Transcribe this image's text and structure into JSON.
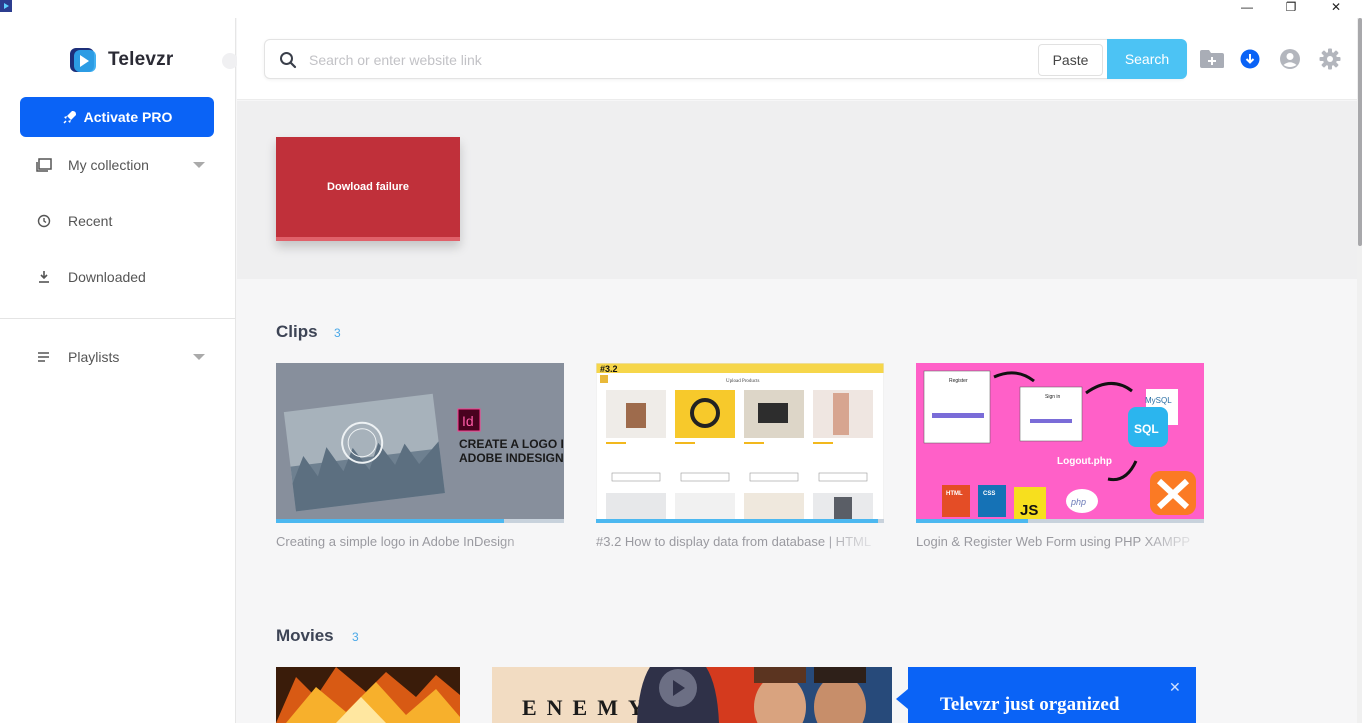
{
  "app": {
    "name": "Televzr"
  },
  "window": {
    "minimize_glyph": "—",
    "restore_glyph": "❐",
    "close_glyph": "✕"
  },
  "sidebar": {
    "activate_label": "Activate PRO",
    "items": [
      {
        "label": "My collection",
        "icon": "collection-icon",
        "has_dropdown": true
      },
      {
        "label": "Recent",
        "icon": "history-icon",
        "has_dropdown": false
      },
      {
        "label": "Downloaded",
        "icon": "download-icon",
        "has_dropdown": false
      },
      {
        "label": "Playlists",
        "icon": "playlist-icon",
        "has_dropdown": true
      }
    ]
  },
  "search": {
    "placeholder": "Search or enter website link",
    "value": "",
    "paste_label": "Paste",
    "search_label": "Search"
  },
  "toolbar": {
    "icons": [
      "add-folder-icon",
      "downloads-icon",
      "account-icon",
      "settings-icon"
    ]
  },
  "failure": {
    "label": "Dowload failure"
  },
  "clips": {
    "title": "Clips",
    "count": "3",
    "items": [
      {
        "caption": "Creating a simple logo in Adobe InDesign",
        "progress": 0.79,
        "thumb_title_line1": "CREATE A LOGO IN",
        "thumb_title_line2": "ADOBE INDESIGN",
        "thumb_badge": "Id"
      },
      {
        "caption": "#3.2 How to display data from database | HTML",
        "progress": 0.98,
        "thumb_tag": "#3.2",
        "thumb_nav": "Upload   Products"
      },
      {
        "caption": "Login & Register Web Form using PHP XAMPP",
        "progress": 0.39,
        "thumb_logout": "Logout.php",
        "thumb_register": "Register",
        "thumb_signin": "Sign in",
        "thumb_sql": "SQL",
        "thumb_mysql": "MySQL",
        "thumb_html": "HTML",
        "thumb_css": "CSS",
        "thumb_js": "JS",
        "thumb_php": "php"
      }
    ]
  },
  "movies": {
    "title": "Movies",
    "count": "3",
    "items": [
      {
        "name": "movie-fire"
      },
      {
        "name": "movie-enemy",
        "thumb_text": "ENEMY"
      }
    ]
  },
  "toast": {
    "text": "Televzr just organized",
    "close_glyph": "✕"
  },
  "colors": {
    "accent": "#0a63f6",
    "search_button": "#4cc3f4",
    "failure": "#c0303a",
    "section_count": "#4aa8e8",
    "progress": "#4cb8f0"
  }
}
